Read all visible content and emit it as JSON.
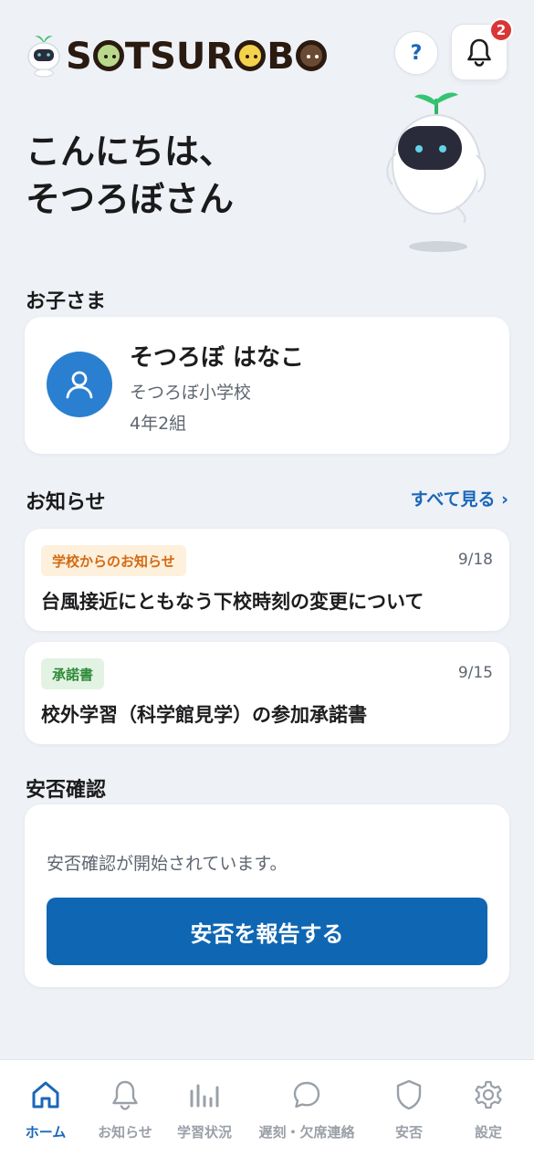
{
  "header": {
    "logo_text": "SOTSUROBO",
    "help_label": "?",
    "notification_count": "2"
  },
  "greeting": {
    "line1": "こんにちは、",
    "line2": "そつろぼさん"
  },
  "children_section": {
    "title": "お子さま",
    "child": {
      "name": "そつろぼ はなこ",
      "school": "そつろぼ小学校",
      "class": "4年2組"
    }
  },
  "notices_section": {
    "title": "お知らせ",
    "see_all": "すべて見る ›",
    "items": [
      {
        "tag": "学校からのお知らせ",
        "date": "9/18",
        "title": "台風接近にともなう下校時刻の変更について"
      },
      {
        "tag": "承諾書",
        "date": "9/15",
        "title": "校外学習（科学館見学）の参加承諾書"
      }
    ]
  },
  "safety_section": {
    "title": "安否確認",
    "message": "安否確認が開始されています。",
    "report_button": "安否を報告する"
  },
  "bottom_nav": {
    "items": [
      {
        "label": "ホーム",
        "icon": "home-icon",
        "active": true
      },
      {
        "label": "お知らせ",
        "icon": "bell-icon",
        "active": false
      },
      {
        "label": "学習状況",
        "icon": "bar-chart-icon",
        "active": false
      },
      {
        "label": "遅刻・欠席連絡",
        "icon": "chat-icon",
        "active": false
      },
      {
        "label": "安否",
        "icon": "shield-icon",
        "active": false
      },
      {
        "label": "設定",
        "icon": "gear-icon",
        "active": false
      }
    ]
  },
  "colors": {
    "background": "#eef1f6",
    "accent": "#1a67b8",
    "primary_button": "#0f66b3",
    "badge": "#d93636",
    "tag_school_text": "#d36a12",
    "tag_consent_text": "#2f8a3a"
  }
}
